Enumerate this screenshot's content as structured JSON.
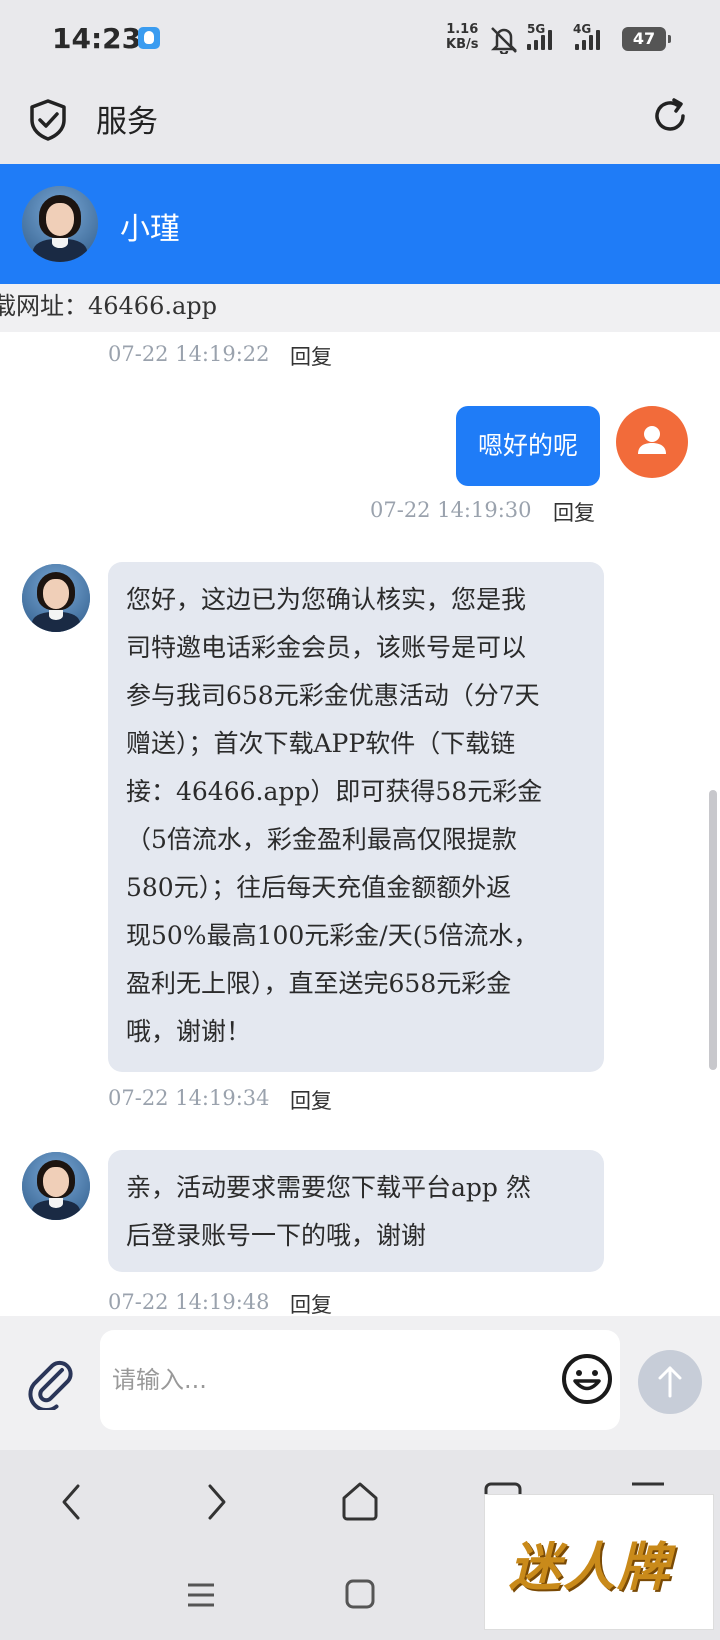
{
  "status_bar": {
    "time": "14:23",
    "net_speed_value": "1.16",
    "net_speed_unit": "KB/s",
    "sim1_label": "5G",
    "sim2_label": "4G",
    "battery": "47"
  },
  "app_header": {
    "title": "服务"
  },
  "chat_header": {
    "agent_name": "小瑾"
  },
  "notice": {
    "text": "载网址：46466.app"
  },
  "messages": [
    {
      "side": "left",
      "time": "07-22 14:19:22",
      "reply_label": "回复"
    },
    {
      "side": "right",
      "text": "嗯好的呢",
      "time": "07-22 14:19:30",
      "reply_label": "回复"
    },
    {
      "side": "left",
      "lines": [
        "您好，这边已为您确认核实，您是我",
        "司特邀电话彩金会员，该账号是可以",
        "参与我司658元彩金优惠活动（分7天",
        "赠送）；首次下载APP软件（下载链",
        "接：46466.app）即可获得58元彩金",
        "（5倍流水，彩金盈利最高仅限提款",
        "580元）；往后每天充值金额额外返",
        "现50%最高100元彩金/天(5倍流水，",
        "盈利无上限），直至送完658元彩金",
        "哦，谢谢！"
      ],
      "time": "07-22 14:19:34",
      "reply_label": "回复"
    },
    {
      "side": "left",
      "lines": [
        "亲，活动要求需要您下载平台app 然",
        "后登录账号一下的哦，谢谢"
      ],
      "time": "07-22 14:19:48",
      "reply_label": "回复"
    }
  ],
  "input": {
    "placeholder": "请输入..."
  },
  "watermark": {
    "text": "迷人牌"
  },
  "colors": {
    "accent": "#1f7cf7",
    "left_bubble": "#e4e8f0",
    "user_avatar": "#f26b3a",
    "send_disabled": "#c7cdd8"
  },
  "icons": [
    "qq-icon",
    "mute-icon",
    "signal-icon",
    "battery-icon",
    "shield-check-icon",
    "refresh-icon",
    "user-icon",
    "paperclip-icon",
    "emoji-icon",
    "arrow-up-icon",
    "back-icon",
    "forward-icon",
    "home-icon",
    "tabs-icon",
    "menu-icon",
    "recents-icon"
  ]
}
